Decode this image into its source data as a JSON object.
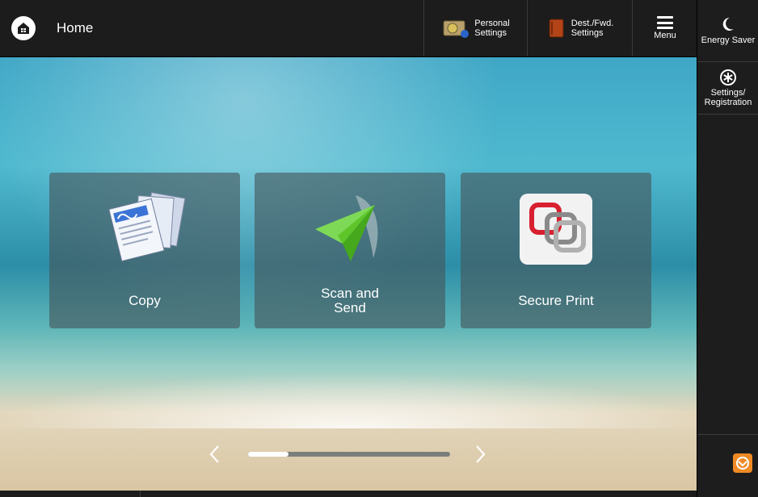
{
  "header": {
    "title": "Home",
    "personal_settings_label": "Personal\nSettings",
    "dest_settings_label": "Dest./Fwd.\nSettings",
    "menu_label": "Menu"
  },
  "sidepanel": {
    "energy_saver_label": "Energy Saver",
    "settings_label": "Settings/\nRegistration"
  },
  "tiles": [
    {
      "label": "Copy"
    },
    {
      "label": "Scan and\nSend"
    },
    {
      "label": "Secure Print"
    }
  ],
  "pager": {
    "current_page_fraction": 0.2
  },
  "colors": {
    "accent_stop": "#f08a24",
    "scan_send_arrow": "#5ec52b",
    "secure_print_red": "#d82030"
  }
}
